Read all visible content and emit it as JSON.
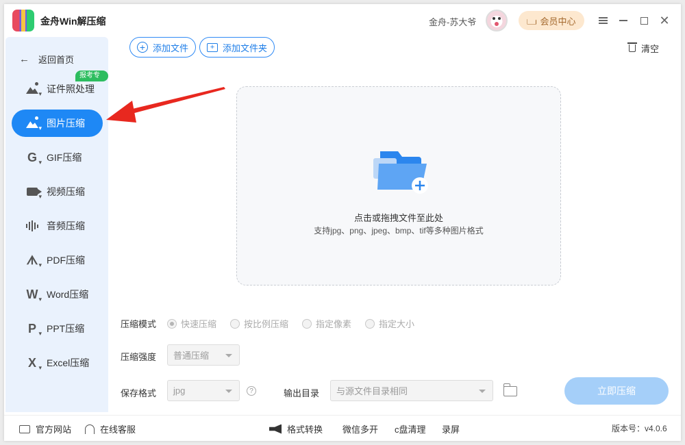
{
  "window": {
    "app_title": "金舟Win解压缩",
    "user_name": "金舟-苏大爷",
    "vip_label": "会员中心"
  },
  "sidebar": {
    "back_label": "返回首页",
    "badge": "报考专用",
    "items": [
      {
        "label": "证件照处理",
        "icon": "id-photo-icon",
        "active": false
      },
      {
        "label": "图片压缩",
        "icon": "image-compress-icon",
        "active": true
      },
      {
        "label": "GIF压缩",
        "icon": "gif-icon",
        "active": false
      },
      {
        "label": "视频压缩",
        "icon": "video-icon",
        "active": false
      },
      {
        "label": "音频压缩",
        "icon": "audio-icon",
        "active": false
      },
      {
        "label": "PDF压缩",
        "icon": "pdf-icon",
        "active": false
      },
      {
        "label": "Word压缩",
        "icon": "word-icon",
        "active": false
      },
      {
        "label": "PPT压缩",
        "icon": "ppt-icon",
        "active": false
      },
      {
        "label": "Excel压缩",
        "icon": "excel-icon",
        "active": false
      }
    ]
  },
  "toolbar": {
    "add_file": "添加文件",
    "add_folder": "添加文件夹",
    "clear": "清空"
  },
  "dropzone": {
    "main_text": "点击或拖拽文件至此处",
    "sub_text": "支持jpg、png、jpeg、bmp、tif等多种图片格式"
  },
  "settings": {
    "mode_label": "压缩模式",
    "modes": [
      "快速压缩",
      "按比例压缩",
      "指定像素",
      "指定大小"
    ],
    "selected_mode": "快速压缩",
    "strength_label": "压缩强度",
    "strength_value": "普通压缩",
    "format_label": "保存格式",
    "format_value": "jpg",
    "help_symbol": "?",
    "output_label": "输出目录",
    "output_value": "与源文件目录相同",
    "start_button": "立即压缩"
  },
  "footer": {
    "website": "官方网站",
    "support": "在线客服",
    "convert": "格式转换",
    "wechat": "微信多开",
    "cleanup": "c盘清理",
    "record": "录屏",
    "version": "版本号：v4.0.6"
  },
  "colors": {
    "accent": "#1e88f5",
    "sidebar_bg": "#eaf2fd",
    "badge": "#2dbd5f",
    "start_btn_disabled": "#a5cff9",
    "annotation_arrow": "#e8281f"
  }
}
